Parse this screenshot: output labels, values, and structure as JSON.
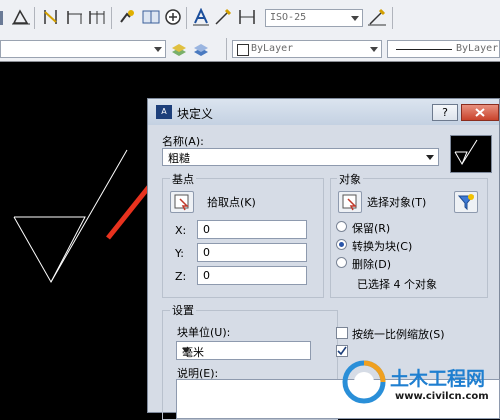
{
  "toolbar": {
    "textstyle_value": "ISO-25",
    "layer_color": "ByLayer",
    "linetype": "ByLayer"
  },
  "dialog": {
    "title": "块定义",
    "help_button": "?",
    "name_label": "名称(A):",
    "name_value": "粗糙",
    "basepoint": {
      "heading": "基点",
      "pick_label": "拾取点(K)",
      "x_label": "X:",
      "x_value": "0",
      "y_label": "Y:",
      "y_value": "0",
      "z_label": "Z:",
      "z_value": "0"
    },
    "objects": {
      "heading": "对象",
      "select_label": "选择对象(T)",
      "retain": "保留(R)",
      "convert": "转换为块(C)",
      "delete": "删除(D)",
      "count_text": "已选择 4 个对象"
    },
    "settings": {
      "heading": "设置",
      "unit_label": "块单位(U):",
      "unit_value": "毫米",
      "desc_label": "说明(E):",
      "uniform_scale": "按统一比例缩放(S)"
    }
  },
  "watermark": {
    "name": "土木工程网",
    "url": "www.civilcn.com"
  },
  "colors": {
    "arrow": "#e8321e",
    "canvas": "#000000",
    "dialog_bg": "#d6dce6"
  }
}
